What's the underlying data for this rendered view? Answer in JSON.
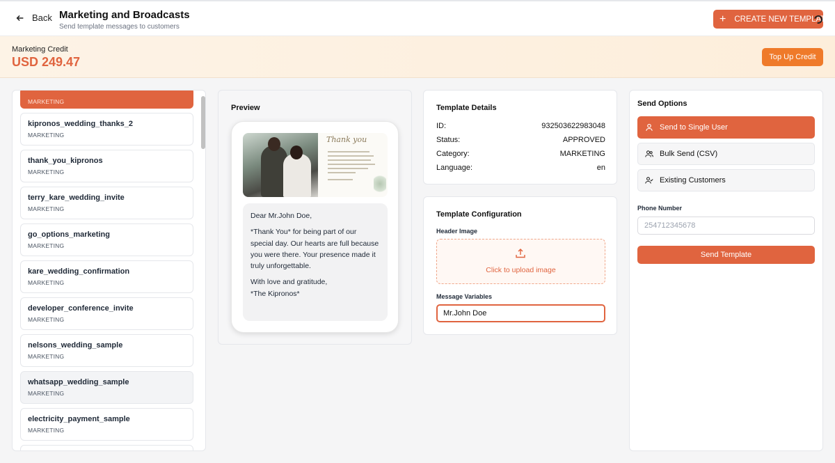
{
  "header": {
    "back_label": "Back",
    "title": "Marketing and Broadcasts",
    "subtitle": "Send template messages to customers",
    "create_button_label": "CREATE NEW TEMPLATE",
    "accent_color": "#e0643f"
  },
  "credit": {
    "label": "Marketing Credit",
    "value": "USD 249.47",
    "topup_label": "Top Up Credit"
  },
  "templates": [
    {
      "name": "",
      "category": "MARKETING"
    },
    {
      "name": "kipronos_wedding_thanks_2",
      "category": "MARKETING"
    },
    {
      "name": "thank_you_kipronos",
      "category": "MARKETING"
    },
    {
      "name": "terry_kare_wedding_invite",
      "category": "MARKETING"
    },
    {
      "name": "go_options_marketing",
      "category": "MARKETING"
    },
    {
      "name": "kare_wedding_confirmation",
      "category": "MARKETING"
    },
    {
      "name": "developer_conference_invite",
      "category": "MARKETING"
    },
    {
      "name": "nelsons_wedding_sample",
      "category": "MARKETING"
    },
    {
      "name": "whatsapp_wedding_sample",
      "category": "MARKETING"
    },
    {
      "name": "electricity_payment_sample",
      "category": "MARKETING"
    }
  ],
  "preview": {
    "title": "Preview",
    "header_card_text": "Thank you",
    "message_lines": [
      "Dear Mr.John Doe,",
      "*Thank You* for being part of our special day. Our hearts are full because you were there. Your presence made it truly unforgettable.",
      "With love and gratitude,\n*The Kipronos*"
    ]
  },
  "details": {
    "title": "Template Details",
    "rows": [
      {
        "label": "ID:",
        "value": "932503622983048"
      },
      {
        "label": "Status:",
        "value": "APPROVED"
      },
      {
        "label": "Category:",
        "value": "MARKETING"
      },
      {
        "label": "Language:",
        "value": "en"
      }
    ]
  },
  "config": {
    "title": "Template Configuration",
    "header_image_label": "Header Image",
    "upload_label": "Click to upload image",
    "variables_label": "Message Variables",
    "variable_value": "Mr.John Doe"
  },
  "send": {
    "title": "Send Options",
    "options": [
      {
        "label": "Send to Single User",
        "icon": "user-icon"
      },
      {
        "label": "Bulk Send (CSV)",
        "icon": "users-icon"
      },
      {
        "label": "Existing Customers",
        "icon": "user-check-icon"
      }
    ],
    "phone_label": "Phone Number",
    "phone_placeholder": "254712345678",
    "send_button_label": "Send Template"
  }
}
